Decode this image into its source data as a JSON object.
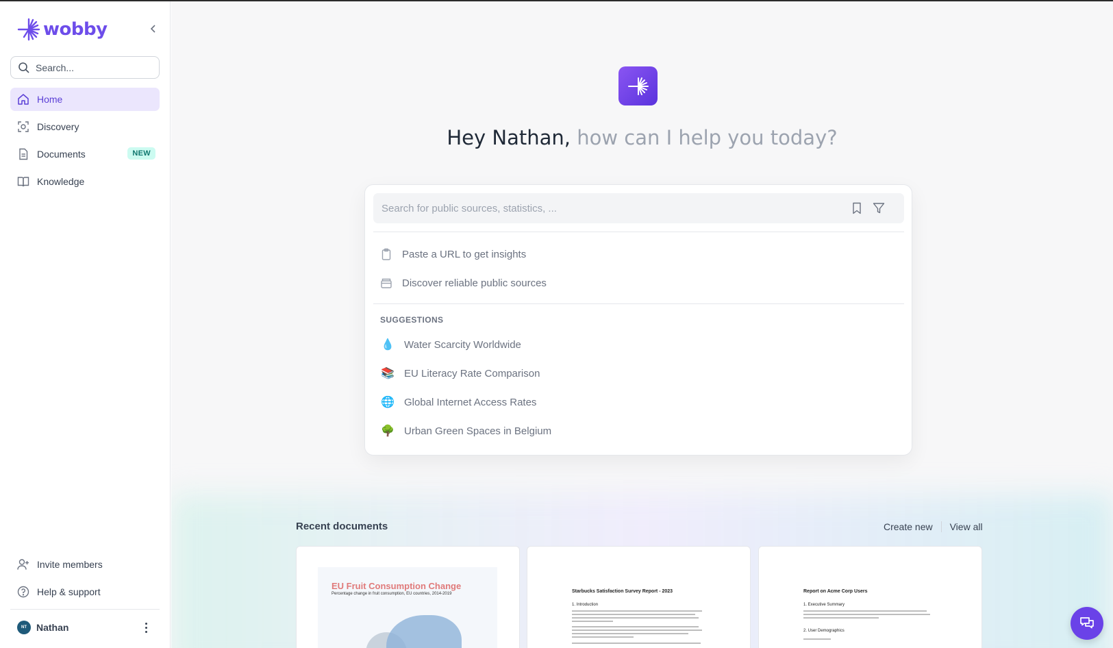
{
  "app": {
    "logo_text": "wobby",
    "brand_color": "#6d4dea"
  },
  "sidebar": {
    "search_placeholder": "Search...",
    "items": [
      {
        "label": "Home",
        "icon": "home-icon",
        "active": true
      },
      {
        "label": "Discovery",
        "icon": "discovery-icon"
      },
      {
        "label": "Documents",
        "icon": "document-icon",
        "badge": "NEW"
      },
      {
        "label": "Knowledge",
        "icon": "book-icon"
      }
    ],
    "bottom_items": [
      {
        "label": "Invite members",
        "icon": "invite-user-icon"
      },
      {
        "label": "Help & support",
        "icon": "help-icon"
      }
    ],
    "user": {
      "initials": "NT",
      "name": "Nathan"
    }
  },
  "main": {
    "greeting_name": "Hey Nathan,",
    "greeting_rest": " how can I help you today?",
    "search_placeholder": "Search for public sources, statistics, ...",
    "actions": [
      {
        "label": "Paste a URL to get insights",
        "icon": "clipboard-icon"
      },
      {
        "label": "Discover reliable public sources",
        "icon": "archive-icon"
      }
    ],
    "suggestions_heading": "SUGGESTIONS",
    "suggestions": [
      {
        "label": "Water Scarcity Worldwide",
        "emoji": "💧"
      },
      {
        "label": "EU Literacy Rate Comparison",
        "emoji": "📚"
      },
      {
        "label": "Global Internet Access Rates",
        "emoji": "🌐"
      },
      {
        "label": "Urban Green Spaces in Belgium",
        "emoji": "🌳"
      }
    ],
    "recent": {
      "title": "Recent documents",
      "create_new": "Create new",
      "view_all": "View all",
      "docs": [
        {
          "title": "EU Fruit Consumption Change",
          "subtitle": "Percentage change in fruit consumption, EU countries, 2014-2019"
        },
        {
          "title": "Starbucks Satisfaction Survey Report - 2023",
          "section": "1. Introduction"
        },
        {
          "title": "Report on Acme Corp Users",
          "section": "1. Executive Summary",
          "section2": "2. User Demographics"
        }
      ]
    }
  }
}
